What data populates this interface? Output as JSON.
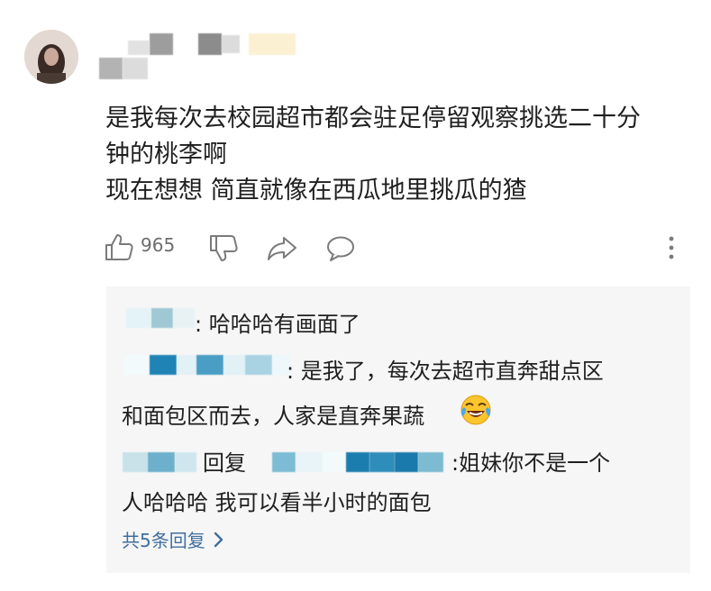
{
  "comment": {
    "lines": [
      "是我每次去校园超市都会驻足停留观察挑选二十分",
      "钟的桃李啊",
      "现在想想 简直就像在西瓜地里挑瓜的猹"
    ],
    "like_count": "965"
  },
  "replies": {
    "r1": {
      "text": ": 哈哈哈有画面了"
    },
    "r2": {
      "line1": ": 是我了，每次去超市直奔甜点区",
      "line2": "和面包区而去，人家是直奔果蔬"
    },
    "r3": {
      "reply_word": "回复",
      "line1": ":姐妹你不是一个",
      "line2": "人哈哈哈 我可以看半小时的面包"
    },
    "more": "共5条回复"
  },
  "icons": [
    "thumbs-up-icon",
    "thumbs-down-icon",
    "share-icon",
    "comment-icon",
    "more-vertical-icon",
    "laughing-crying-emoji-icon",
    "chevron-right-icon"
  ],
  "colors": {
    "link": "#3f6f9d",
    "reply_bg": "#f6f6f6",
    "icon_gray": "#7a7a7a"
  }
}
